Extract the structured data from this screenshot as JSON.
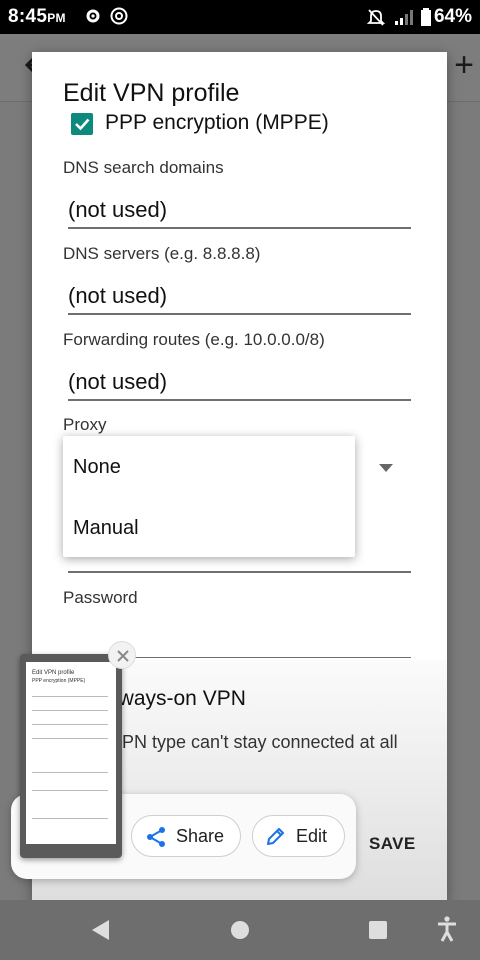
{
  "status_bar": {
    "time": "8:45",
    "ampm": "PM",
    "battery": "64%"
  },
  "dialog": {
    "title": "Edit VPN profile",
    "ppp_encryption_label": "PPP encryption (MPPE)",
    "ppp_encryption_checked": true,
    "fields": [
      {
        "label": "DNS search domains",
        "value": "(not used)"
      },
      {
        "label": "DNS servers (e.g. 8.8.8.8)",
        "value": "(not used)"
      },
      {
        "label": "Forwarding routes (e.g. 10.0.0.0/8)",
        "value": "(not used)"
      }
    ],
    "proxy_label": "Proxy",
    "password_label": "Password",
    "always_on_label": "lways-on VPN",
    "always_on_desc": "PN type can't stay connected at all",
    "save_label": "SAVE"
  },
  "proxy_dropdown": {
    "options": [
      "None",
      "Manual"
    ]
  },
  "screenshot_toolbar": {
    "share_label": "Share",
    "edit_label": "Edit"
  },
  "colors": {
    "accent": "#0d8a7c",
    "toolbar_blue": "#1a73e8"
  }
}
